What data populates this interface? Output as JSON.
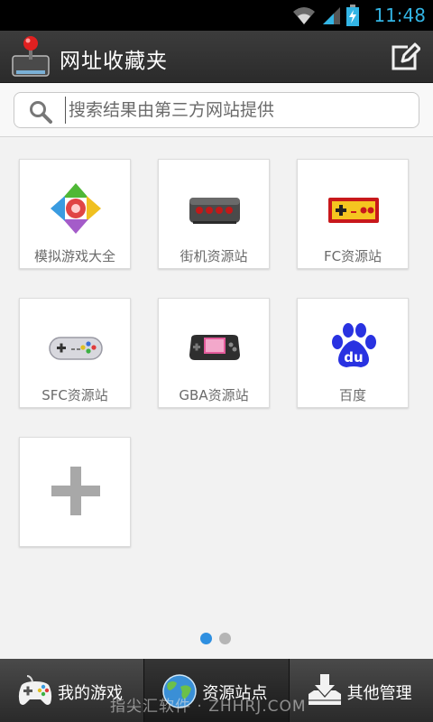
{
  "status_bar": {
    "time": "11:48"
  },
  "header": {
    "title": "网址收藏夹",
    "edit_icon": "edit-icon",
    "logo_icon": "joystick-logo-icon"
  },
  "search": {
    "placeholder": "搜索结果由第三方网站提供",
    "value": ""
  },
  "grid": {
    "tiles": [
      {
        "label": "模拟游戏大全",
        "icon": "emulator-pad-icon"
      },
      {
        "label": "街机资源站",
        "icon": "arcade-stick-icon"
      },
      {
        "label": "FC资源站",
        "icon": "fc-controller-icon"
      },
      {
        "label": "SFC资源站",
        "icon": "sfc-controller-icon"
      },
      {
        "label": "GBA资源站",
        "icon": "gba-handheld-icon"
      },
      {
        "label": "百度",
        "icon": "baidu-paw-icon"
      },
      {
        "label": "",
        "icon": "add-icon"
      }
    ]
  },
  "pager": {
    "pages": 2,
    "current": 1
  },
  "tabs": [
    {
      "label": "我的游戏",
      "icon": "gamepad-icon"
    },
    {
      "label": "资源站点",
      "icon": "globe-icon",
      "active": true
    },
    {
      "label": "其他管理",
      "icon": "download-manage-icon"
    }
  ],
  "watermark": "指尖汇软件 · ZHHRJ.COM",
  "colors": {
    "accent": "#33b5e5",
    "page_dot_active": "#2e8fe0",
    "title_bar": "#333333"
  }
}
